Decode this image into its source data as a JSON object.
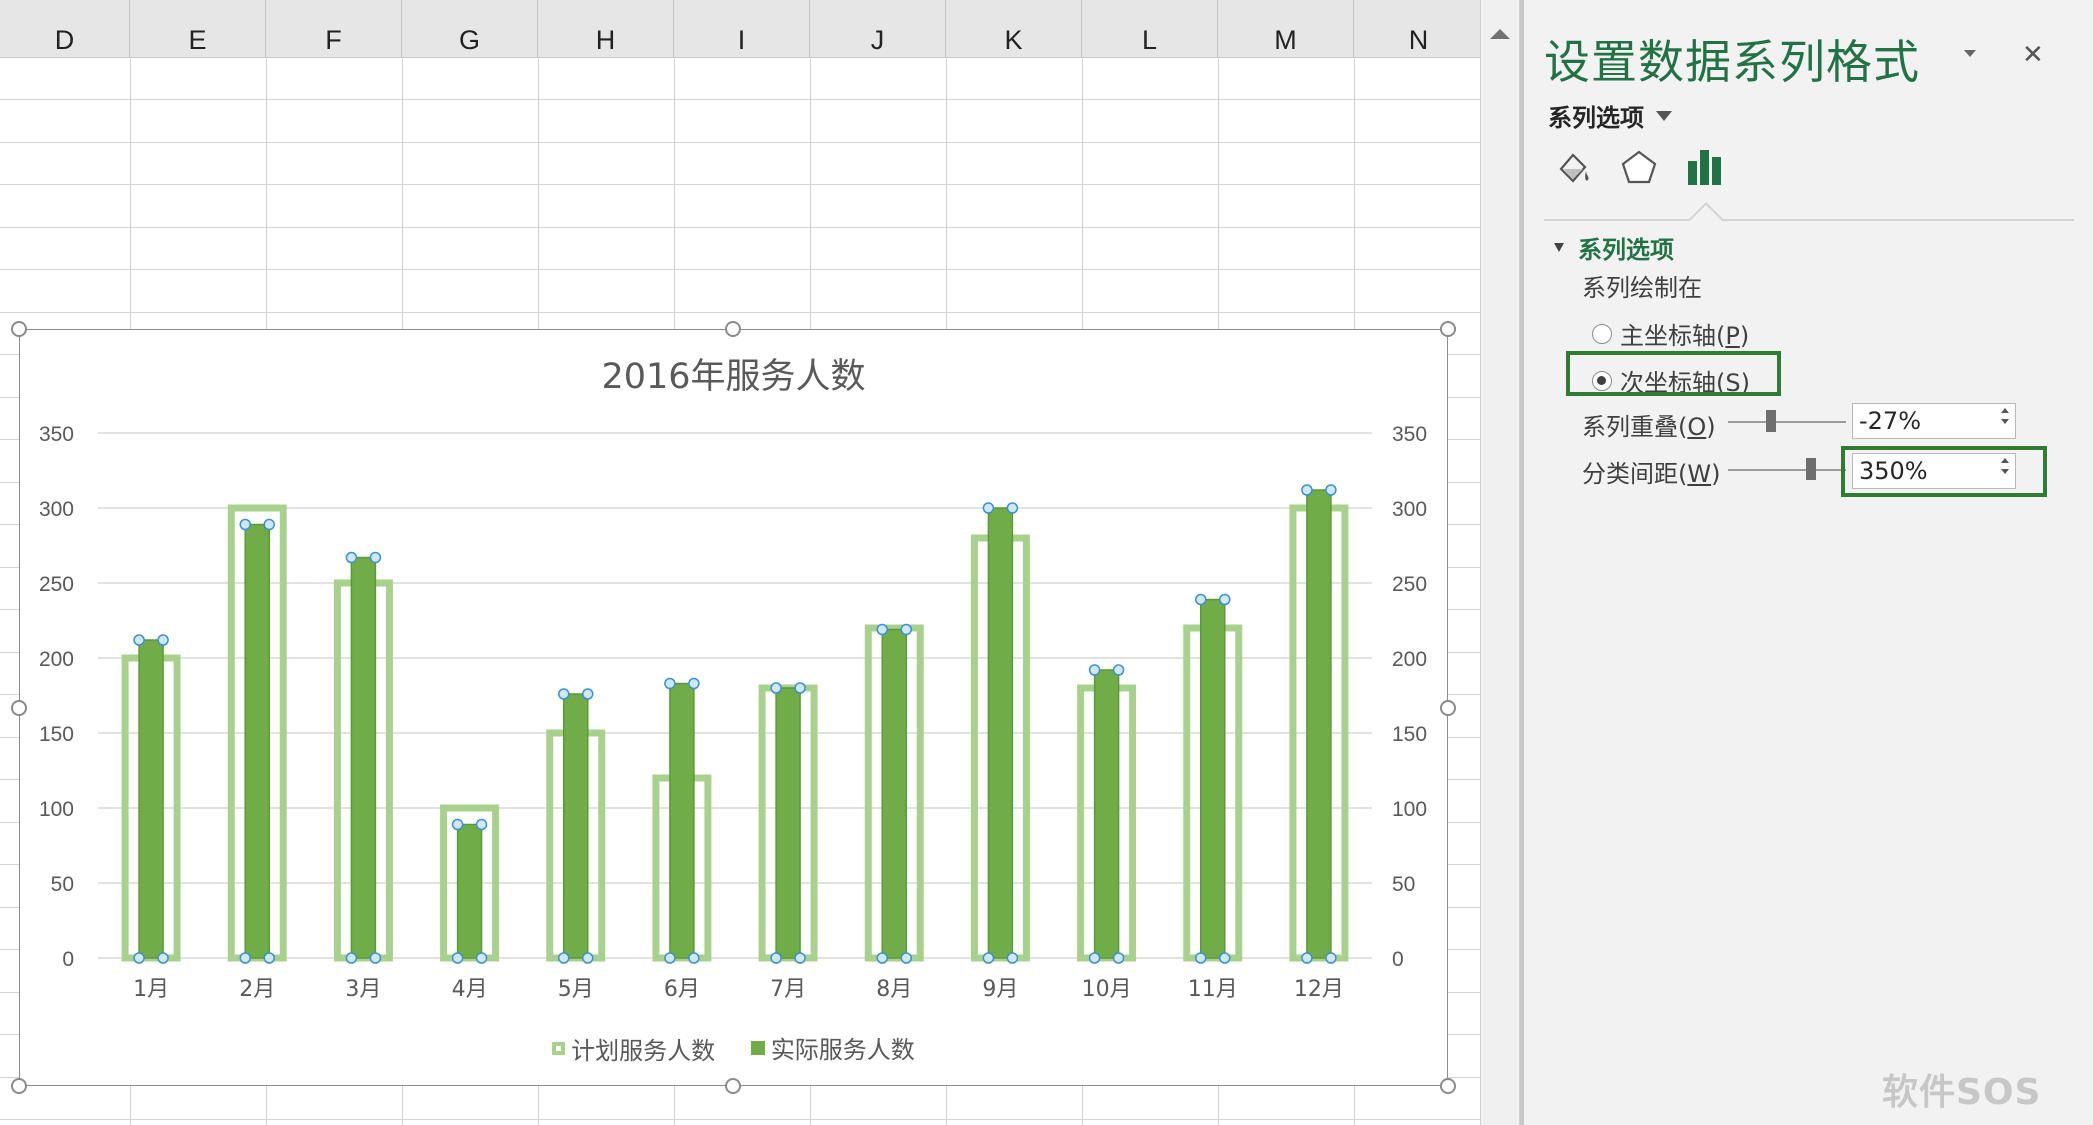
{
  "sheet": {
    "columns": [
      "D",
      "E",
      "F",
      "G",
      "H",
      "I",
      "J",
      "K",
      "L",
      "M",
      "N"
    ]
  },
  "chart_data": {
    "type": "bar",
    "title": "2016年服务人数",
    "categories": [
      "1月",
      "2月",
      "3月",
      "4月",
      "5月",
      "6月",
      "7月",
      "8月",
      "9月",
      "10月",
      "11月",
      "12月"
    ],
    "series": [
      {
        "name": "计划服务人数",
        "axis": "primary",
        "style": "outline",
        "color": "#a9d18e",
        "values": [
          200,
          300,
          250,
          100,
          150,
          120,
          180,
          220,
          280,
          180,
          220,
          300
        ]
      },
      {
        "name": "实际服务人数",
        "axis": "secondary",
        "style": "filled",
        "color": "#70ad47",
        "values": [
          212,
          289,
          267,
          89,
          176,
          183,
          180,
          219,
          300,
          192,
          239,
          312
        ]
      }
    ],
    "ylim": [
      0,
      350
    ],
    "yticks": [
      "0",
      "50",
      "100",
      "150",
      "200",
      "250",
      "300",
      "350"
    ],
    "y2ticks": [
      "0",
      "50",
      "100",
      "150",
      "200",
      "250",
      "300",
      "350"
    ],
    "grid": true,
    "legend": "bottom"
  },
  "pane": {
    "title": "设置数据系列格式",
    "options_dropdown": "系列选项",
    "tab_icons": [
      "fill-line-icon",
      "effects-icon",
      "series-options-icon"
    ],
    "section_title": "系列选项",
    "plot_on_label": "系列绘制在",
    "primary_axis": {
      "label": "主坐标轴(",
      "key": "P",
      "suffix": ")",
      "checked": false
    },
    "secondary_axis": {
      "label": "次坐标轴(",
      "key": "S",
      "suffix": ")",
      "checked": true
    },
    "overlap": {
      "label": "系列重叠(",
      "key": "O",
      "suffix": ")",
      "value": "-27%",
      "level": -0.27
    },
    "gap_width": {
      "label": "分类间距(",
      "key": "W",
      "suffix": ")",
      "value": "350%",
      "level": 0.7
    },
    "accent_color": "#217346"
  },
  "watermark": "软件SOS"
}
